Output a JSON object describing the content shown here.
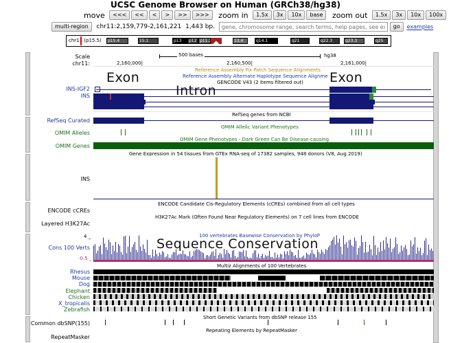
{
  "app_title": "UCSC Genome Browser on Human (GRCh38/hg38)",
  "nav": {
    "move_label": "move",
    "move_buttons": [
      "<<<",
      "<<",
      "<",
      ">",
      ">>",
      ">>>"
    ],
    "zoom_in_label": "zoom in",
    "zoom_in_buttons": [
      "1.5x",
      "3x",
      "10x",
      "base"
    ],
    "zoom_out_label": "zoom out",
    "zoom_out_buttons": [
      "1.5x",
      "3x",
      "10x",
      "100x"
    ]
  },
  "position_row": {
    "multi_region_label": "multi-region",
    "position": "chr11:2,159,779-2,161,221",
    "size": "1,443 bp.",
    "search_placeholder": "gene, chromosome range, search terms, help pages, see exampl",
    "go_label": "go",
    "examples_link": "examples"
  },
  "ideogram": {
    "chrom_label": "chr11 (p15.5)",
    "bands": [
      "p15.4",
      "15.1",
      "p13",
      "p12",
      "p11.2",
      "13.4",
      "q14.1",
      "q21",
      "q22.3",
      "q23.3",
      "q25"
    ]
  },
  "scale": {
    "scale_label": "Scale",
    "chrom_label": "chr11:",
    "bar_label": "500 bases",
    "assembly": "hg38",
    "ticks": [
      "2,160,000|",
      "2,160,500|",
      "2,161,000|"
    ]
  },
  "tracks": {
    "fix_patch": "Reference Assembly Fix Patch Sequence Alignments",
    "alt_haplotype": "Reference Assembly Alternate Haplotype Sequence Alignme",
    "gencode": "GENCODE V43 (2 items filtered out)",
    "gene_labels": [
      "INS-IGF2",
      "INS"
    ],
    "refseq_label": "RefSeq Curated",
    "refseq_title": "RefSeq genes from NCBI",
    "omim_alleles_label": "OMIM Alleles",
    "omim_alleles_title": "OMIM Allelic Variant Phenotypes",
    "omim_genes_label": "OMIM Genes",
    "omim_genes_title": "OMIM Gene Phenotypes - Dark Green Can Be Disease-causing",
    "gtex_title": "Gene Expression in 54 tissues from GTEx RNA-seq of 17382 samples, 948 donors (V8, Aug 2019)",
    "gtex_label": "INS",
    "encode_label": "ENCODE cCREs",
    "encode_title": "ENCODE Candidate Cis-Regulatory Elements (cCREs) combined from all cell types",
    "h3k27ac_label": "Layered H3K27Ac",
    "h3k27ac_title": "H3K27Ac Mark (Often Found Near Regulatory Elements) on 7 cell lines from ENCODE",
    "cons_label": "Cons 100 Verts",
    "cons_max": "4 _",
    "cons_min": "-0.5 _",
    "phylop_title": "100 vertebrates Basewise Conservation by PhyloP",
    "multiz_title": "Multiz Alignments of 100 Vertebrates",
    "species": [
      "Rhesus",
      "Mouse",
      "Dog",
      "Elephant",
      "Chicken",
      "X_tropicalis",
      "Zebrafish"
    ],
    "dbsnp_label": "Common dbSNP(155)",
    "dbsnp_title": "Short Genetic Variants from dbSNP release 155",
    "repeat_label": "RepeatMasker",
    "repeat_title": "Repeating Elements by RepeatMasker"
  },
  "overlays": {
    "exon_left": "Exon",
    "intron": "Intron",
    "exon_right": "Exon",
    "conservation": "Sequence Conservation"
  },
  "colors": {
    "gene": "#141875",
    "omim_green": "#0a5f0a",
    "gtex_bar": "#c49a1c",
    "phylop": "#2b2b8c",
    "phylop_neg": "#b0306f",
    "fix_patch_text": "#b08c1c"
  }
}
